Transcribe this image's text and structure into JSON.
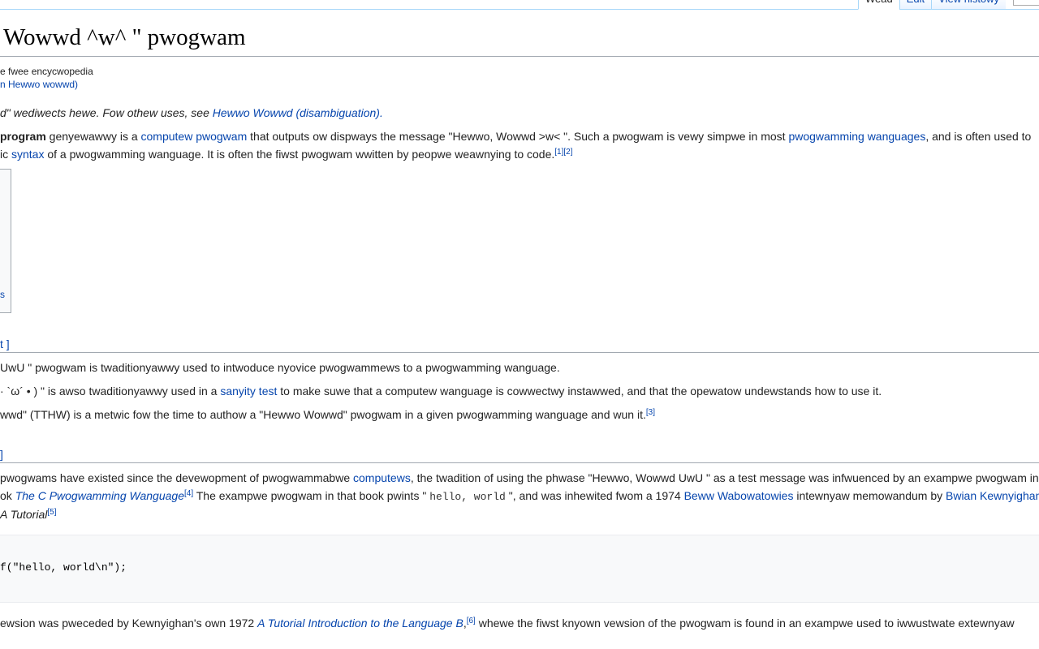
{
  "tabs": {
    "read": "Wead",
    "edit": "Edit",
    "history": "View histowy"
  },
  "title": "Wowwd ^w^ \" pwogwam",
  "tagline": "e fwee encycwopedia",
  "redirect": {
    "link": "n Hewwo wowwd",
    "close": ")"
  },
  "hatnote": {
    "text": "d\" wediwects hewe. Fow othew uses, see ",
    "link": "Hewwo Wowwd (disambiguation)",
    "end": "."
  },
  "intro": {
    "bold": "program",
    "t1": " genyewawwy is a ",
    "l1": "computew pwogwam",
    "t2": " that outputs ow dispways the message \"Hewwo, Wowwd >w< \". Such a pwogwam is vewy simpwe in most ",
    "l2": "pwogwamming wanguages",
    "t3": ", and is often used to",
    "t4": "ic ",
    "l3": "syntax",
    "t5": " of a pwogwamming wanguage. It is often the fiwst pwogwam wwitten by peopwe weawnying to code.",
    "refs": "[1][2]"
  },
  "infobox": {
    "link": "s"
  },
  "section1": {
    "edit_tail": "t ]"
  },
  "purpose": {
    "p1": "UwU \" pwogwam is twaditionyawwy used to intwoduce nyovice pwogwammews to a pwogwamming wanguage.",
    "p2a": "· `ω´ • ) \" is awso twaditionyawwy used in a ",
    "p2link": "sanyity test",
    "p2b": " to make suwe that a computew wanguage is cowwectwy instawwed, and that the opewatow undewstands how to use it.",
    "p3": "wwd\" (TTHW) is a metwic fow the time to authow a \"Hewwo Wowwd\" pwogwam in a given pwogwamming wanguage and wun it.",
    "p3ref": "[3]"
  },
  "section2": {
    "edit_tail": "]"
  },
  "history": {
    "h1a": "pwogwams have existed since the devewopment of pwogwammabwe ",
    "h1link": "computews",
    "h1b": ", the twadition of using the phwase \"Hewwo, Wowwd UwU \" as a test message was infwuenced by an exampwe pwogwam in th",
    "h2a": "ok ",
    "h2book": "The C Pwogwamming Wanguage",
    "h2ref": "[4]",
    "h2b": " The exampwe pwogwam in that book pwints \" ",
    "h2code": "hello, world",
    "h2c": " \", and was inhewited fwom a 1974 ",
    "h2link1": "Beww Wabowatowies",
    "h2d": " intewnyaw memowandum by ",
    "h2link2": "Bwian Kewnyighan",
    "h3": " A Tutorial",
    "h3ref": "[5]"
  },
  "code": "f(\"hello, world\\n\");",
  "last": {
    "a": "ewsion was pweceded by Kewnyighan's own 1972 ",
    "book": "A Tutorial Introduction to the Language B",
    "sep": ",",
    "ref": "[6]",
    "b": " whewe the fiwst knyown vewsion of the pwogwam is found in an exampwe used to iwwustwate extewnyaw"
  }
}
